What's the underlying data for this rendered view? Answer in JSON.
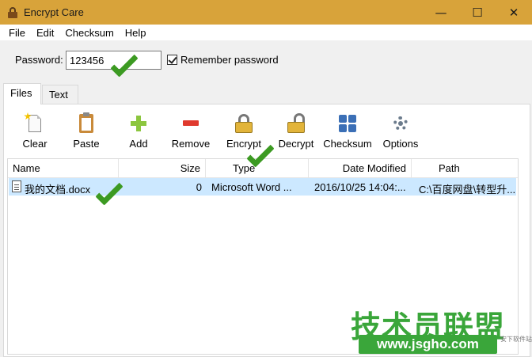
{
  "window": {
    "title": "Encrypt Care",
    "icon": "padlock-app-icon"
  },
  "window_controls": {
    "minimize": "—",
    "maximize": "☐",
    "close": "✕"
  },
  "menu": [
    "File",
    "Edit",
    "Checksum",
    "Help"
  ],
  "password": {
    "label": "Password:",
    "value": "123456",
    "remember_label": "Remember password",
    "remember_checked": true
  },
  "tabs": [
    "Files",
    "Text"
  ],
  "toolbar": {
    "clear": "Clear",
    "paste": "Paste",
    "add": "Add",
    "remove": "Remove",
    "encrypt": "Encrypt",
    "decrypt": "Decrypt",
    "checksum": "Checksum",
    "options": "Options"
  },
  "columns": {
    "name": "Name",
    "size": "Size",
    "type": "Type",
    "date_modified": "Date Modified",
    "path": "Path"
  },
  "files": [
    {
      "name": "我的文档.docx",
      "size": "0",
      "type": "Microsoft Word ...",
      "date_modified": "2016/10/25 14:04:...",
      "path": "C:\\百度网盘\\转型升..."
    }
  ],
  "watermark": {
    "title": "技术员联盟",
    "url": "www.jsgho.com",
    "small": "安下软件站"
  },
  "colors": {
    "titlebar": "#d8a33a",
    "selection": "#cce8ff",
    "annotation_check": "#3c9a22",
    "watermark_green": "#3aa63a"
  }
}
